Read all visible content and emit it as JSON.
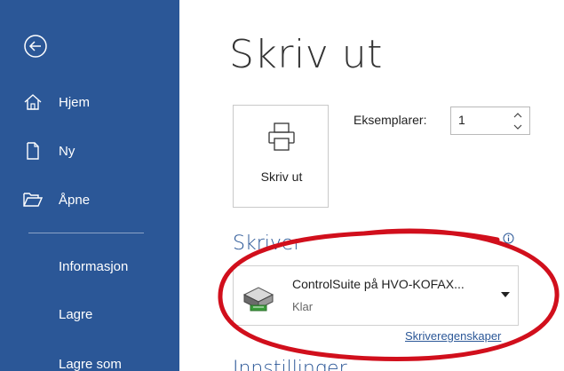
{
  "sidebar": {
    "items": [
      {
        "label": "Hjem",
        "icon": "home-icon"
      },
      {
        "label": "Ny",
        "icon": "new-document-icon"
      },
      {
        "label": "Åpne",
        "icon": "open-folder-icon"
      },
      {
        "label": "Informasjon"
      },
      {
        "label": "Lagre"
      },
      {
        "label": "Lagre som"
      }
    ]
  },
  "main": {
    "title": "Skriv ut",
    "print_button_label": "Skriv ut",
    "copies_label": "Eksemplarer:",
    "copies_value": "1",
    "printer_section_title": "Skriver",
    "printer_name": "ControlSuite på HVO-KOFAX...",
    "printer_status": "Klar",
    "printer_properties_link": "Skriveregenskaper",
    "settings_section_title": "Innstillinger"
  },
  "colors": {
    "sidebar": "#2b5797",
    "accent": "#2b5797",
    "annotation": "#d10f1c"
  }
}
